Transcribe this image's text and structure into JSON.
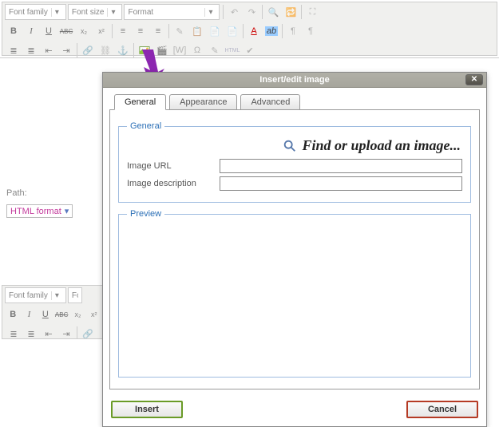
{
  "toolbar": {
    "font_family": "Font family",
    "font_size": "Font size",
    "format": "Format"
  },
  "path_label": "Path:",
  "format_select": "HTML format",
  "dialog": {
    "title": "Insert/edit image",
    "tabs": {
      "general": "General",
      "appearance": "Appearance",
      "advanced": "Advanced"
    },
    "general_legend": "General",
    "find_label": "Find or upload an image...",
    "image_url_label": "Image URL",
    "image_desc_label": "Image description",
    "preview_legend": "Preview",
    "insert": "Insert",
    "cancel": "Cancel"
  },
  "icons": {
    "bold": "B",
    "italic": "I",
    "underline": "U",
    "strike": "ABC",
    "sub": "x",
    "sup": "x",
    "html": "HTML"
  }
}
